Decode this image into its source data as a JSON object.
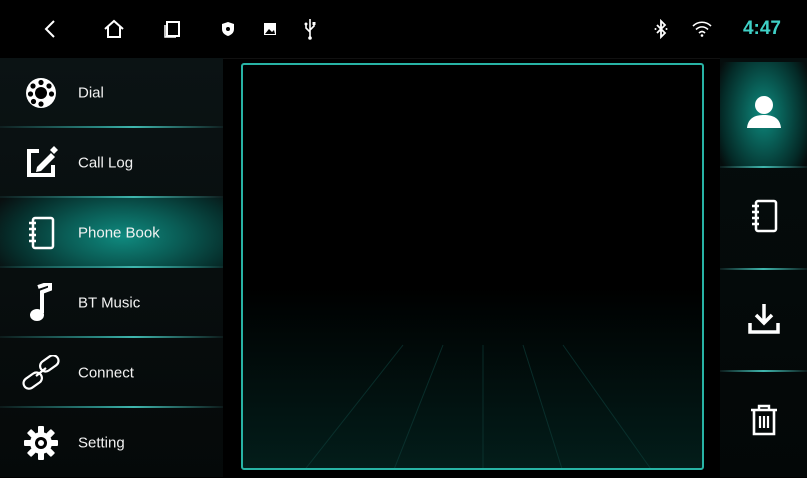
{
  "status_bar": {
    "time": "4:47",
    "left_icons": [
      "back-icon",
      "home-icon",
      "recents-icon",
      "shield-icon",
      "image-icon",
      "usb-icon"
    ],
    "right_icons": [
      "bluetooth-icon",
      "wifi-icon"
    ],
    "accent_color": "#3fd0c6"
  },
  "sidebar": {
    "items": [
      {
        "label": "Dial",
        "icon": "rotary-dial-icon"
      },
      {
        "label": "Call Log",
        "icon": "call-log-icon"
      },
      {
        "label": "Phone Book",
        "icon": "phone-book-icon",
        "active": true
      },
      {
        "label": "BT Music",
        "icon": "music-note-icon"
      },
      {
        "label": "Connect",
        "icon": "link-icon"
      },
      {
        "label": "Setting",
        "icon": "gear-icon"
      }
    ]
  },
  "right_toolbar": {
    "items": [
      {
        "icon": "contact-icon",
        "active": true
      },
      {
        "icon": "phone-book-icon"
      },
      {
        "icon": "download-icon"
      },
      {
        "icon": "trash-icon"
      }
    ]
  },
  "colors": {
    "panel_border": "#28b3a5",
    "active_glow": "#0f8a7f"
  }
}
